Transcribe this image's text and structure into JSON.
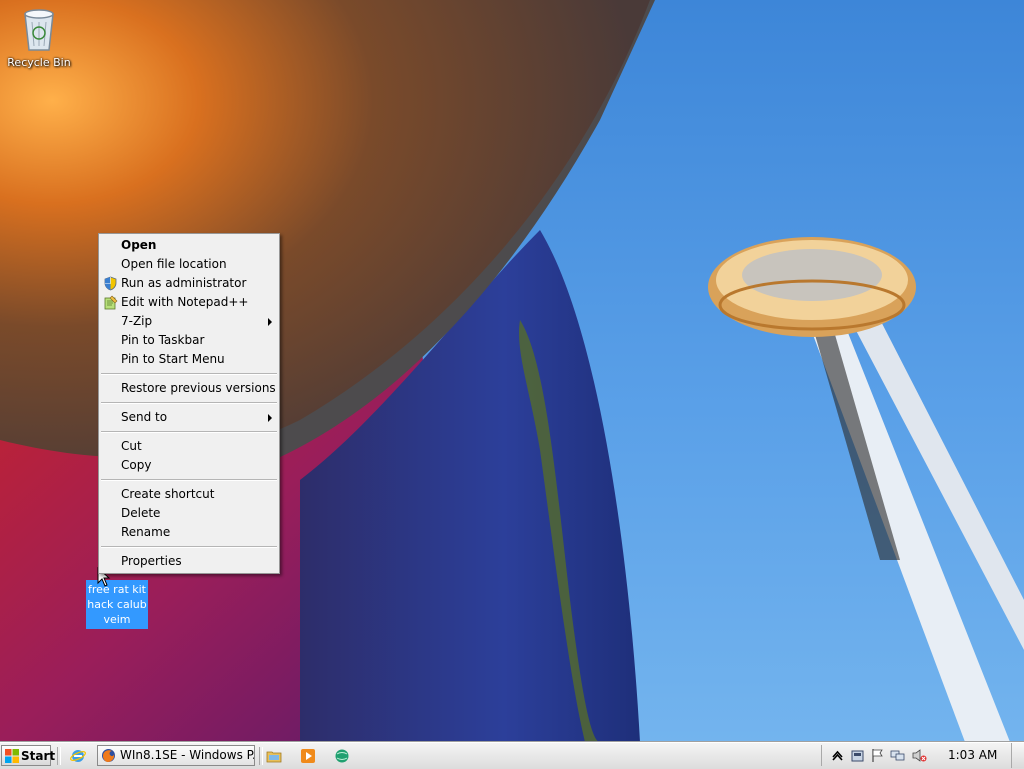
{
  "desktop": {
    "icons": [
      {
        "label": "Recycle Bin",
        "icon": "recycle-bin-icon"
      },
      {
        "label": "free rat kit hack calub veim",
        "icon": "shortcut-file-icon",
        "selected": true
      }
    ]
  },
  "context_menu": {
    "items": [
      {
        "label": "Open",
        "bold": true
      },
      {
        "label": "Open file location"
      },
      {
        "label": "Run as administrator",
        "icon": "uac-shield-icon"
      },
      {
        "label": "Edit with Notepad++",
        "icon": "notepad-plus-plus-icon"
      },
      {
        "label": "7-Zip",
        "submenu": true
      },
      {
        "label": "Pin to Taskbar"
      },
      {
        "label": "Pin to Start Menu"
      },
      {
        "label": "Restore previous versions"
      },
      {
        "label": "Send to",
        "submenu": true
      },
      {
        "label": "Cut"
      },
      {
        "label": "Copy"
      },
      {
        "label": "Create shortcut"
      },
      {
        "label": "Delete"
      },
      {
        "label": "Rename"
      },
      {
        "label": "Properties"
      }
    ]
  },
  "taskbar": {
    "start_label": "Start",
    "quick_launch": [
      "internet-explorer-icon",
      "firefox-icon"
    ],
    "active_window": {
      "label": "WIn8.1SE - Windows P...",
      "icon": "firefox-icon"
    },
    "pinned": [
      "explorer-folder-icon",
      "media-player-icon",
      "network-globe-icon"
    ],
    "tray": {
      "icons": [
        "show-hidden-icons-chevron",
        "safely-remove-hardware-icon",
        "action-center-flag-icon",
        "network-icon",
        "volume-muted-icon"
      ],
      "time": "1:03 AM"
    }
  },
  "colors": {
    "selection_blue": "#3399ff",
    "menu_background": "#f0f0f0",
    "sky_blue": "#3d86d8"
  }
}
